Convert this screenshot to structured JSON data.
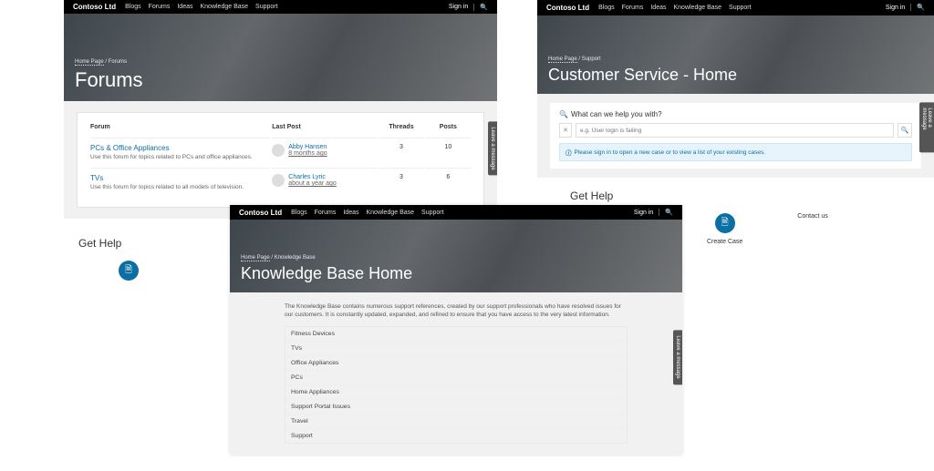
{
  "brand": "Contoso Ltd",
  "nav": {
    "items": [
      "Blogs",
      "Forums",
      "Ideas",
      "Knowledge Base",
      "Support"
    ],
    "signin": "Sign in"
  },
  "leave_message": "Leave a message",
  "forums": {
    "crumb_home": "Home Page",
    "crumb_here": "Forums",
    "title": "Forums",
    "columns": {
      "forum": "Forum",
      "lastpost": "Last Post",
      "threads": "Threads",
      "posts": "Posts"
    },
    "rows": [
      {
        "title": "PCs & Office Appliances",
        "desc": "Use this forum for topics related to PCs and office appliances.",
        "poster": "Abby Hansen",
        "when": "8 months ago",
        "threads": "3",
        "posts": "10"
      },
      {
        "title": "TVs",
        "desc": "Use this forum for topics related to all models of television.",
        "poster": "Charles Lyric",
        "when": "about a year ago",
        "threads": "3",
        "posts": "6"
      }
    ]
  },
  "cs": {
    "crumb_home": "Home Page",
    "crumb_here": "Support",
    "title": "Customer Service - Home",
    "search_heading": "What can we help you with?",
    "search_placeholder": "e.g. User login is failing",
    "banner": "Please sign in to open a new case or to view a list of your existing cases."
  },
  "help": {
    "heading": "Get Help",
    "create_case": "Create Case",
    "contact_us": "Contact us"
  },
  "kb": {
    "crumb_home": "Home Page",
    "crumb_here": "Knowledge Base",
    "title": "Knowledge Base Home",
    "intro": "The Knowledge Base contains numerous support references, created by our support professionals who have resolved issues for our customers. It is constantly updated, expanded, and refined to ensure that you have access to the very latest information.",
    "categories": [
      "Fitness Devices",
      "TVs",
      "Office Appliances",
      "PCs",
      "Home Appliances",
      "Support Portal Issues",
      "Travel",
      "Support"
    ]
  }
}
